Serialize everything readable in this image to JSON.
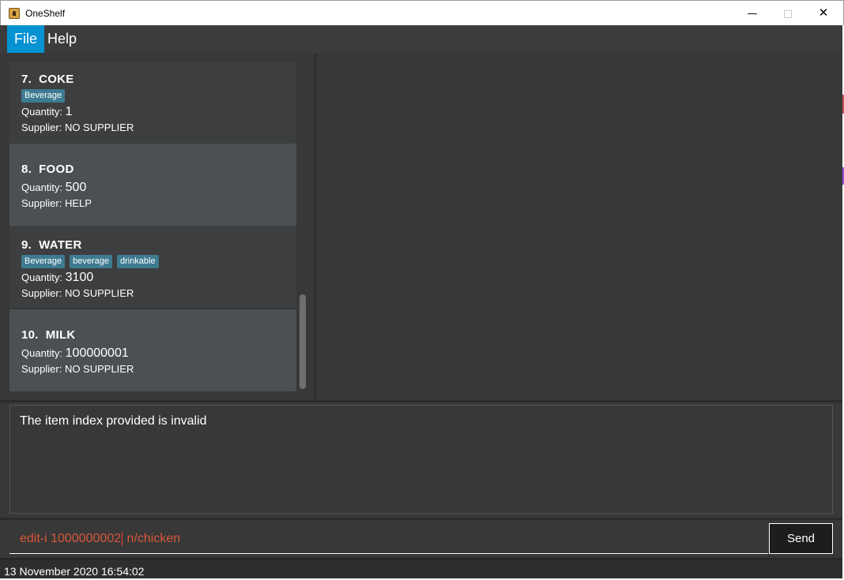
{
  "window": {
    "title": "OneShelf",
    "minimize_glyph": "—",
    "maximize_glyph": "□",
    "close_glyph": "✕"
  },
  "menu": {
    "file": "File",
    "help": "Help"
  },
  "list": {
    "items": [
      {
        "index": "7.",
        "name": "COKE",
        "tags": [
          "Beverage"
        ],
        "quantity_label": "Quantity:",
        "quantity": "1",
        "supplier_label": "Supplier:",
        "supplier": "NO SUPPLIER"
      },
      {
        "index": "8.",
        "name": "FOOD",
        "tags": [],
        "quantity_label": "Quantity:",
        "quantity": "500",
        "supplier_label": "Supplier:",
        "supplier": "HELP"
      },
      {
        "index": "9.",
        "name": "WATER",
        "tags": [
          "Beverage",
          "beverage",
          "drinkable"
        ],
        "quantity_label": "Quantity:",
        "quantity": "3100",
        "supplier_label": "Supplier:",
        "supplier": "NO SUPPLIER"
      },
      {
        "index": "10.",
        "name": "MILK",
        "tags": [],
        "quantity_label": "Quantity:",
        "quantity": "100000001",
        "supplier_label": "Supplier:",
        "supplier": "NO SUPPLIER"
      }
    ]
  },
  "result": {
    "text": "The item index provided is invalid"
  },
  "command": {
    "before_caret": "edit-i 1000000002",
    "after_caret": " n/chicken",
    "send_label": "Send"
  },
  "status": {
    "datetime": "13 November 2020 16:54:02"
  },
  "colors": {
    "accent": "#0592d3",
    "tag": "#3e7b91",
    "error_text": "#d9573a"
  }
}
